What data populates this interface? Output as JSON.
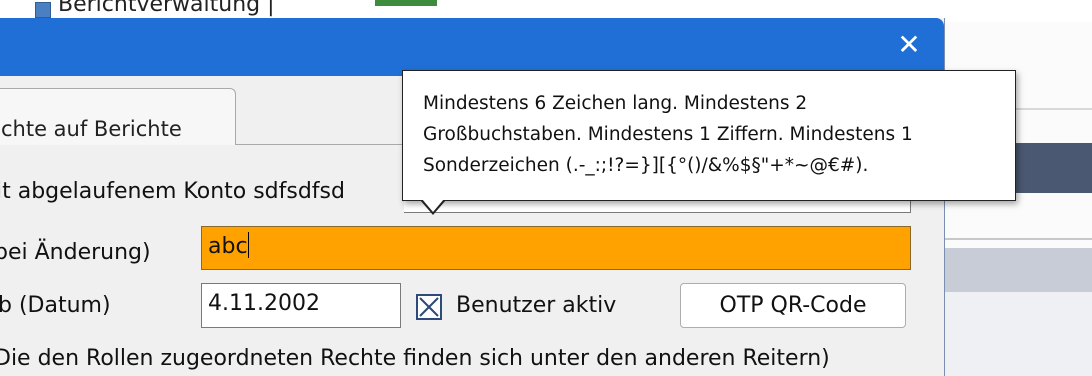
{
  "background_app": {
    "title": "Berichtverwaltung |"
  },
  "dialog": {
    "close_label": "✕",
    "tab_label": "chte auf Berichte",
    "account_text": "it abgelaufenem Konto sdfsdfsd",
    "password_label": "bei Änderung)",
    "password_value": "abc",
    "date_label": "b (Datum)",
    "date_value": "4.11.2002",
    "active_checkbox_label": "Benutzer aktiv",
    "active_checked": true,
    "otp_button_label": "OTP QR-Code",
    "roles_note": "Die den Rollen zugeordneten Rechte finden sich unter den anderen Reitern)"
  },
  "tooltip": {
    "lines": [
      "Mindestens 6 Zeichen lang. Mindestens 2",
      "Großbuchstaben. Mindestens 1 Ziffern. Mindestens 1",
      "Sonderzeichen (.-_:;!?=}][{°()/&%$§\"+*~@€#)."
    ]
  },
  "colors": {
    "title_bar": "#1f6fd6",
    "password_highlight": "#ffa200"
  }
}
